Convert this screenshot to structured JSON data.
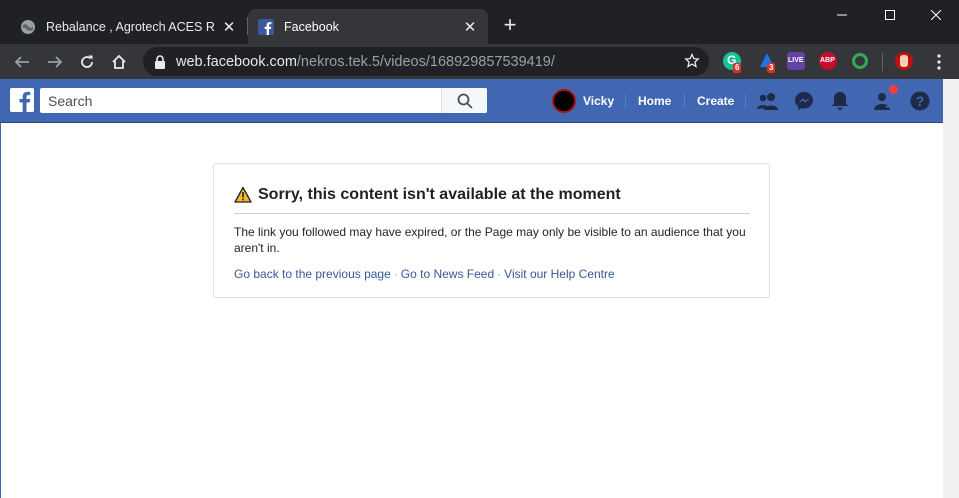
{
  "browser": {
    "tabs": [
      {
        "title": "Rebalance , Agrotech ACES Rifle",
        "active": false,
        "favicon": "globe-icon"
      },
      {
        "title": "Facebook",
        "active": true,
        "favicon": "facebook-icon"
      }
    ],
    "address_bar": {
      "host": "web.facebook.com",
      "path": "/nekros.tek.5/videos/168929857539419/"
    },
    "extensions": [
      {
        "name": "grammarly-ext-icon",
        "badge": "6",
        "color": "#15c39a"
      },
      {
        "name": "vpn-ext-icon",
        "badge": "3",
        "color": "#1a73e8"
      },
      {
        "name": "live-ext-icon",
        "label": "LIVE",
        "color": "#6441a5"
      },
      {
        "name": "adblock-plus-icon",
        "label": "ABP",
        "color": "#c70d2c"
      },
      {
        "name": "ring-ext-icon",
        "color": "#34a853"
      }
    ]
  },
  "fb": {
    "search_placeholder": "Search",
    "profile_name": "Vicky",
    "home_label": "Home",
    "create_label": "Create",
    "brand_color": "#4267b2"
  },
  "error": {
    "title": "Sorry, this content isn't available at the moment",
    "body": "The link you followed may have expired, or the Page may only be visible to an audience that you aren't in.",
    "links": [
      "Go back to the previous page",
      "Go to News Feed",
      "Visit our Help Centre"
    ],
    "separator": "·"
  }
}
